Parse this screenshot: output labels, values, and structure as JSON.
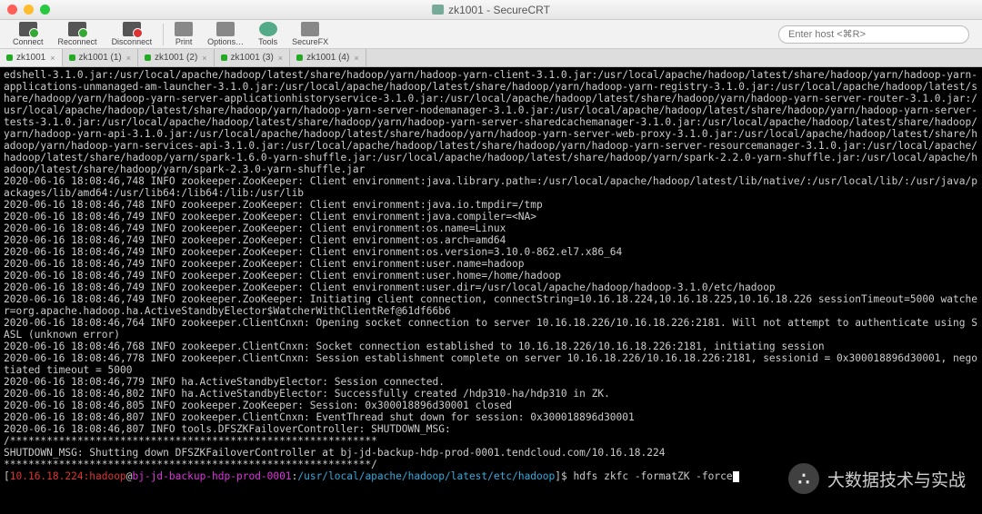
{
  "window": {
    "title": "zk1001 - SecureCRT"
  },
  "toolbar": {
    "connect": "Connect",
    "reconnect": "Reconnect",
    "disconnect": "Disconnect",
    "print": "Print",
    "options": "Options…",
    "tools": "Tools",
    "securefx": "SecureFX"
  },
  "hostbox": {
    "placeholder": "Enter host <⌘R>"
  },
  "tabs": [
    {
      "label": "zk1001"
    },
    {
      "label": "zk1001 (1)"
    },
    {
      "label": "zk1001 (2)"
    },
    {
      "label": "zk1001 (3)"
    },
    {
      "label": "zk1001 (4)"
    }
  ],
  "terminal": {
    "lines": [
      "edshell-3.1.0.jar:/usr/local/apache/hadoop/latest/share/hadoop/yarn/hadoop-yarn-client-3.1.0.jar:/usr/local/apache/hadoop/latest/share/hadoop/yarn/hadoop-yarn-applications-unmanaged-am-launcher-3.1.0.jar:/usr/local/apache/hadoop/latest/share/hadoop/yarn/hadoop-yarn-registry-3.1.0.jar:/usr/local/apache/hadoop/latest/share/hadoop/yarn/hadoop-yarn-server-applicationhistoryservice-3.1.0.jar:/usr/local/apache/hadoop/latest/share/hadoop/yarn/hadoop-yarn-server-router-3.1.0.jar:/usr/local/apache/hadoop/latest/share/hadoop/yarn/hadoop-yarn-server-nodemanager-3.1.0.jar:/usr/local/apache/hadoop/latest/share/hadoop/yarn/hadoop-yarn-server-tests-3.1.0.jar:/usr/local/apache/hadoop/latest/share/hadoop/yarn/hadoop-yarn-server-sharedcachemanager-3.1.0.jar:/usr/local/apache/hadoop/latest/share/hadoop/yarn/hadoop-yarn-api-3.1.0.jar:/usr/local/apache/hadoop/latest/share/hadoop/yarn/hadoop-yarn-server-web-proxy-3.1.0.jar:/usr/local/apache/hadoop/latest/share/hadoop/yarn/hadoop-yarn-services-api-3.1.0.jar:/usr/local/apache/hadoop/latest/share/hadoop/yarn/hadoop-yarn-server-resourcemanager-3.1.0.jar:/usr/local/apache/hadoop/latest/share/hadoop/yarn/spark-1.6.0-yarn-shuffle.jar:/usr/local/apache/hadoop/latest/share/hadoop/yarn/spark-2.2.0-yarn-shuffle.jar:/usr/local/apache/hadoop/latest/share/hadoop/yarn/spark-2.3.0-yarn-shuffle.jar",
      "2020-06-16 18:08:46,748 INFO zookeeper.ZooKeeper: Client environment:java.library.path=:/usr/local/apache/hadoop/latest/lib/native/:/usr/local/lib/:/usr/java/packages/lib/amd64:/usr/lib64:/lib64:/lib:/usr/lib",
      "2020-06-16 18:08:46,748 INFO zookeeper.ZooKeeper: Client environment:java.io.tmpdir=/tmp",
      "2020-06-16 18:08:46,749 INFO zookeeper.ZooKeeper: Client environment:java.compiler=<NA>",
      "2020-06-16 18:08:46,749 INFO zookeeper.ZooKeeper: Client environment:os.name=Linux",
      "2020-06-16 18:08:46,749 INFO zookeeper.ZooKeeper: Client environment:os.arch=amd64",
      "2020-06-16 18:08:46,749 INFO zookeeper.ZooKeeper: Client environment:os.version=3.10.0-862.el7.x86_64",
      "2020-06-16 18:08:46,749 INFO zookeeper.ZooKeeper: Client environment:user.name=hadoop",
      "2020-06-16 18:08:46,749 INFO zookeeper.ZooKeeper: Client environment:user.home=/home/hadoop",
      "2020-06-16 18:08:46,749 INFO zookeeper.ZooKeeper: Client environment:user.dir=/usr/local/apache/hadoop/hadoop-3.1.0/etc/hadoop",
      "2020-06-16 18:08:46,749 INFO zookeeper.ZooKeeper: Initiating client connection, connectString=10.16.18.224,10.16.18.225,10.16.18.226 sessionTimeout=5000 watcher=org.apache.hadoop.ha.ActiveStandbyElector$WatcherWithClientRef@61df66b6",
      "2020-06-16 18:08:46,764 INFO zookeeper.ClientCnxn: Opening socket connection to server 10.16.18.226/10.16.18.226:2181. Will not attempt to authenticate using SASL (unknown error)",
      "2020-06-16 18:08:46,768 INFO zookeeper.ClientCnxn: Socket connection established to 10.16.18.226/10.16.18.226:2181, initiating session",
      "2020-06-16 18:08:46,778 INFO zookeeper.ClientCnxn: Session establishment complete on server 10.16.18.226/10.16.18.226:2181, sessionid = 0x300018896d30001, negotiated timeout = 5000",
      "2020-06-16 18:08:46,779 INFO ha.ActiveStandbyElector: Session connected.",
      "2020-06-16 18:08:46,802 INFO ha.ActiveStandbyElector: Successfully created /hdp310-ha/hdp310 in ZK.",
      "2020-06-16 18:08:46,805 INFO zookeeper.ZooKeeper: Session: 0x300018896d30001 closed",
      "2020-06-16 18:08:46,807 INFO zookeeper.ClientCnxn: EventThread shut down for session: 0x300018896d30001",
      "2020-06-16 18:08:46,807 INFO tools.DFSZKFailoverController: SHUTDOWN_MSG:",
      "/************************************************************",
      "SHUTDOWN_MSG: Shutting down DFSZKFailoverController at bj-jd-backup-hdp-prod-0001.tendcloud.com/10.16.18.224",
      "************************************************************/"
    ],
    "prompt": {
      "bracket_open": "[",
      "host1": "10.16.18.224:hadoop",
      "at": "@",
      "host2": "bj-jd-backup-hdp-prod-0001",
      "colon": ":",
      "path": "/usr/local/apache/hadoop/latest/etc/hadoop",
      "bracket_close": "]$ ",
      "command": "hdfs zkfc -formatZK -force"
    }
  },
  "watermark": {
    "icon": "∴",
    "text": "大数据技术与实战"
  }
}
